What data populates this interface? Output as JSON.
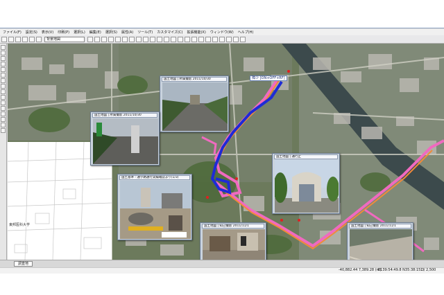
{
  "menu": [
    "ファイル(F)",
    "設定(S)",
    "表示(V)",
    "印刷(P)",
    "選択(L)",
    "編集(E)",
    "選択(S)",
    "属性(A)",
    "ツール(T)",
    "カスタマイズ(C)",
    "拡張機能(X)",
    "ウィンドウ(W)",
    "ヘルプ(H)"
  ],
  "toolbar": {
    "layer_combo": "背景地図"
  },
  "callout": {
    "label": "障少 [ON+OFF+RF]"
  },
  "photos": [
    {
      "caption": "国土地図 | 所属撮影 2011/10/30"
    },
    {
      "caption": "国土地図 | 所属撮影 2011/10/30"
    },
    {
      "caption": "国土地図 | 通行止"
    },
    {
      "caption": "国土基準 : 通学路通行実績確認より(1/3)"
    },
    {
      "caption": "国土地図 | 知己撮影 2011/11/1"
    },
    {
      "caption": "国土地図 | 知己撮影 2011/11/1"
    }
  ],
  "map_labels": {
    "university": "東邦医科大学"
  },
  "tab": {
    "label": "調査地"
  },
  "status": {
    "coords": "-40,882.44 7,389.28 (m)",
    "latlon": "E139:54:49.8 N35:38:15.3",
    "scale": "1 / 2,500"
  },
  "colors": {
    "route_blue": "#1e2bd6",
    "route_pink": "#f06ac0",
    "route_orange": "#f28a3a",
    "river": "#3c4a4c"
  }
}
